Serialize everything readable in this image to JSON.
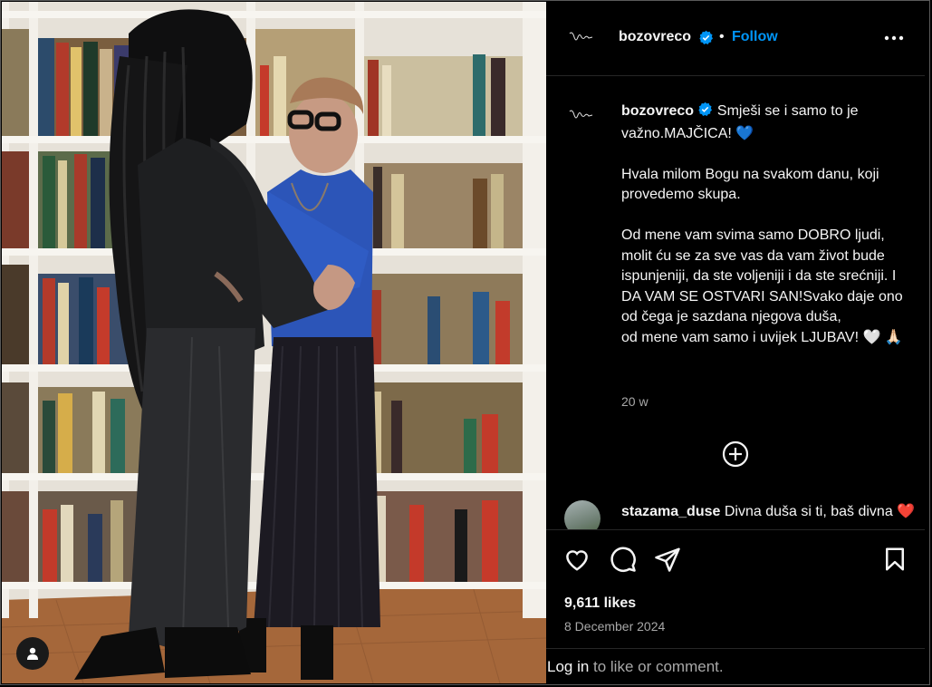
{
  "post": {
    "username": "bozovreco",
    "follow_label": "Follow",
    "separator": "•",
    "caption_first": "Smješi se i samo to je važno.MAJČICA! 💙",
    "caption_paragraphs": [
      "Hvala milom Bogu na svakom danu, koji provedemo skupa.",
      "Od mene vam svima samo DOBRO ljudi, molit ću se za sve vas da vam život bude ispunjeniji, da ste voljeniji i da ste srećniji. I DA VAM SE OSTVARI SAN!Svako daje ono od čega je sazdana njegova duša,",
      "od mene vam samo i uvijek LJUBAV! 🤍 🙏🏻"
    ],
    "time_ago": "20 w",
    "likes": "9,611 likes",
    "date": "8 December 2024"
  },
  "comment": {
    "username": "stazama_duse",
    "text": "Divna duša si ti, baš divna ❤️"
  },
  "login": {
    "link": "Log in",
    "rest": "to like or comment."
  },
  "colors": {
    "accent": "#0095f6",
    "background": "#000000",
    "secondary_text": "#a8a8a8",
    "divider": "#262626"
  },
  "icons": [
    "signature-avatar-icon",
    "verified-badge-icon",
    "more-options-icon",
    "add-comment-icon",
    "heart-icon",
    "comment-icon",
    "share-icon",
    "bookmark-icon",
    "user-tag-icon"
  ]
}
